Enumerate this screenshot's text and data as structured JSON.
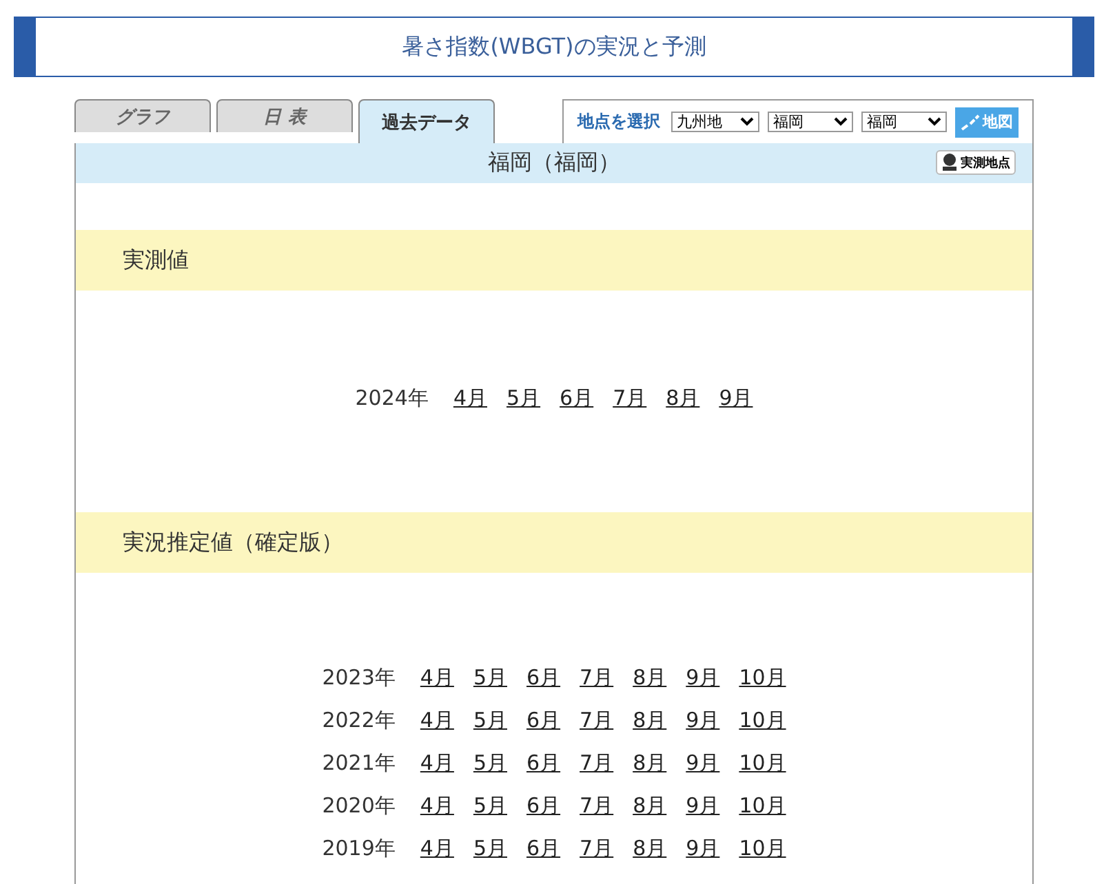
{
  "header": {
    "title": "暑さ指数(WBGT)の実況と予測"
  },
  "tabs": [
    {
      "label": "グラフ",
      "selected": false
    },
    {
      "label": "日 表",
      "selected": false
    },
    {
      "label": "過去データ",
      "selected": true
    }
  ],
  "selector": {
    "label": "地点を選択",
    "dropdowns": [
      "九州地",
      "福岡",
      "福岡"
    ],
    "map_button": "地図"
  },
  "location": {
    "title": "福岡（福岡）",
    "observation_button": "実測地点"
  },
  "sections": [
    {
      "heading": "実測値",
      "years": [
        {
          "year": "2024年",
          "months": [
            "4月",
            "5月",
            "6月",
            "7月",
            "8月",
            "9月"
          ]
        }
      ]
    },
    {
      "heading": "実況推定値（確定版）",
      "years": [
        {
          "year": "2023年",
          "months": [
            "4月",
            "5月",
            "6月",
            "7月",
            "8月",
            "9月",
            "10月"
          ]
        },
        {
          "year": "2022年",
          "months": [
            "4月",
            "5月",
            "6月",
            "7月",
            "8月",
            "9月",
            "10月"
          ]
        },
        {
          "year": "2021年",
          "months": [
            "4月",
            "5月",
            "6月",
            "7月",
            "8月",
            "9月",
            "10月"
          ]
        },
        {
          "year": "2020年",
          "months": [
            "4月",
            "5月",
            "6月",
            "7月",
            "8月",
            "9月",
            "10月"
          ]
        },
        {
          "year": "2019年",
          "months": [
            "4月",
            "5月",
            "6月",
            "7月",
            "8月",
            "9月",
            "10月"
          ]
        }
      ]
    }
  ]
}
